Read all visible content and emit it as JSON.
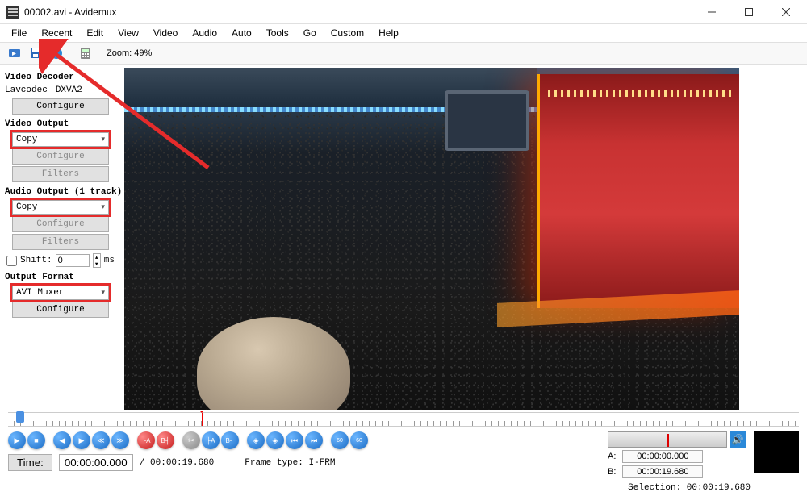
{
  "window": {
    "title": "00002.avi - Avidemux"
  },
  "menu": {
    "file": "File",
    "recent": "Recent",
    "edit": "Edit",
    "view": "View",
    "video": "Video",
    "audio": "Audio",
    "auto": "Auto",
    "tools": "Tools",
    "go": "Go",
    "custom": "Custom",
    "help": "Help"
  },
  "toolbar": {
    "zoom": "Zoom: 49%"
  },
  "sidebar": {
    "decoder_title": "Video Decoder",
    "decoder_codec": "Lavcodec",
    "decoder_accel": "DXVA2",
    "configure": "Configure",
    "video_out_title": "Video Output",
    "video_out_value": "Copy",
    "filters": "Filters",
    "audio_out_title": "Audio Output (1 track)",
    "audio_out_value": "Copy",
    "shift_label": "Shift:",
    "shift_value": "0",
    "shift_unit": "ms",
    "format_title": "Output Format",
    "format_value": "AVI Muxer"
  },
  "timeline": {
    "time_label": "Time:",
    "time_value": "00:00:00.000",
    "total": "/ 00:00:19.680",
    "frame_type": "Frame type: I-FRM",
    "a_label": "A:",
    "a_value": "00:00:00.000",
    "b_label": "B:",
    "b_value": "00:00:19.680",
    "selection": "Selection: 00:00:19.680"
  }
}
